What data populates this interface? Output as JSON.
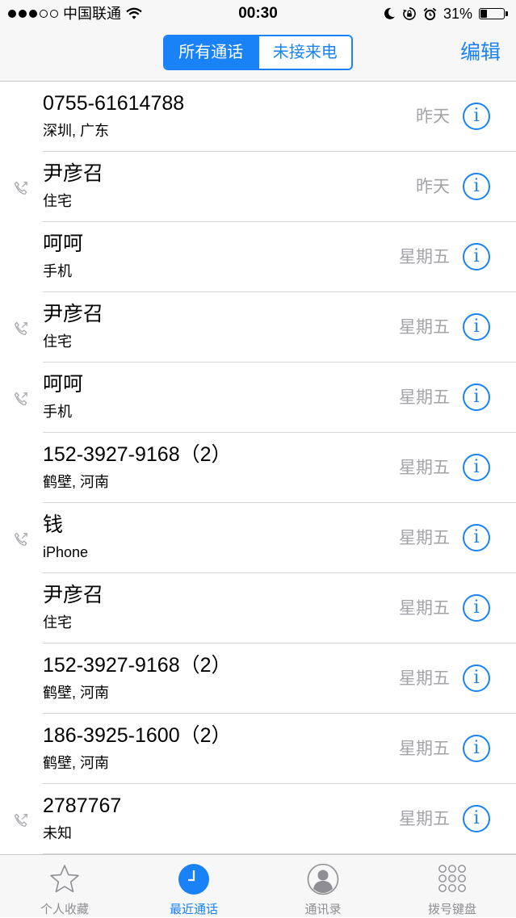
{
  "status_bar": {
    "carrier": "中国联通",
    "time": "00:30",
    "battery_percent": "31%",
    "battery_level": 0.31
  },
  "header": {
    "segments": [
      "所有通话",
      "未接来电"
    ],
    "active_segment": 0,
    "edit_label": "编辑"
  },
  "calls": [
    {
      "name": "0755-61614788",
      "sub": "深圳, 广东",
      "date": "昨天",
      "outgoing": false
    },
    {
      "name": "尹彦召",
      "sub": "住宅",
      "date": "昨天",
      "outgoing": true
    },
    {
      "name": "呵呵",
      "sub": "手机",
      "date": "星期五",
      "outgoing": false
    },
    {
      "name": "尹彦召",
      "sub": "住宅",
      "date": "星期五",
      "outgoing": true
    },
    {
      "name": "呵呵",
      "sub": "手机",
      "date": "星期五",
      "outgoing": true
    },
    {
      "name": "152-3927-9168（2）",
      "sub": "鹤壁, 河南",
      "date": "星期五",
      "outgoing": false
    },
    {
      "name": "钱",
      "sub": "iPhone",
      "date": "星期五",
      "outgoing": true
    },
    {
      "name": "尹彦召",
      "sub": "住宅",
      "date": "星期五",
      "outgoing": false
    },
    {
      "name": "152-3927-9168（2）",
      "sub": "鹤壁, 河南",
      "date": "星期五",
      "outgoing": false
    },
    {
      "name": "186-3925-1600（2）",
      "sub": "鹤壁, 河南",
      "date": "星期五",
      "outgoing": false
    },
    {
      "name": "2787767",
      "sub": "未知",
      "date": "星期五",
      "outgoing": true
    }
  ],
  "info_symbol": "i",
  "tabs": [
    {
      "label": "个人收藏",
      "icon": "star-icon",
      "active": false
    },
    {
      "label": "最近通话",
      "icon": "clock-icon",
      "active": true
    },
    {
      "label": "通讯录",
      "icon": "contact-icon",
      "active": false
    },
    {
      "label": "拨号键盘",
      "icon": "keypad-icon",
      "active": false
    }
  ],
  "colors": {
    "accent": "#1a82f7",
    "secondary_text": "#a3a3a8",
    "tab_inactive": "#8e8e93"
  }
}
